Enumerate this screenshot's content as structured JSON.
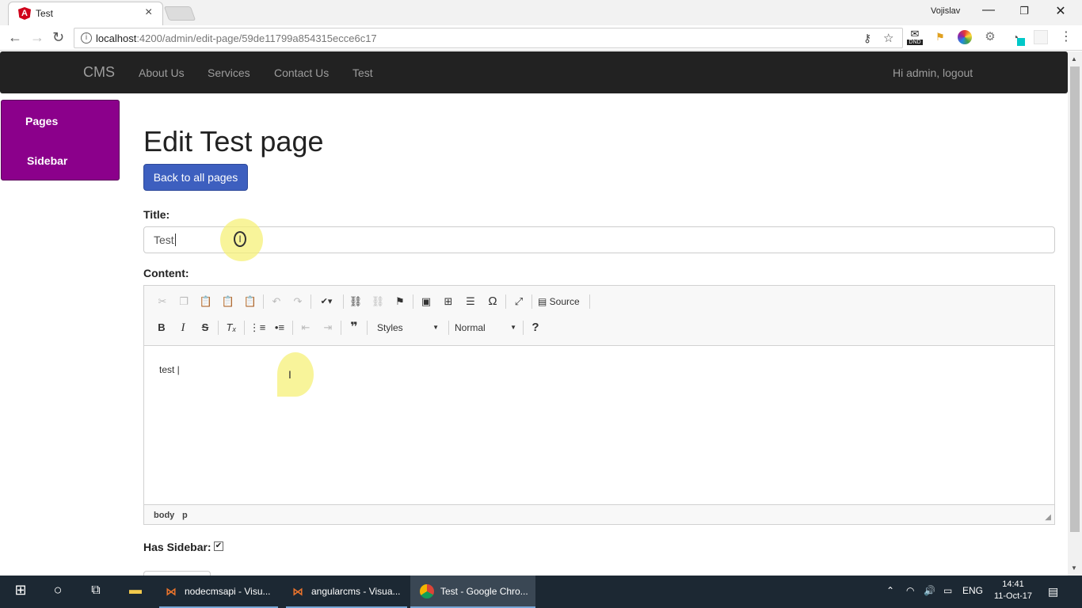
{
  "browser": {
    "tab_title": "Test",
    "tab_favicon": "A",
    "profile_name": "Vojislav",
    "url_host": "localhost",
    "url_path": ":4200/admin/edit-page/59de11799a854315ecce6c17",
    "ext_dnd": "DND"
  },
  "navbar": {
    "brand": "CMS",
    "links": [
      "About Us",
      "Services",
      "Contact Us",
      "Test"
    ],
    "user": "Hi admin, logout"
  },
  "sidebar": {
    "items": [
      "Pages",
      "Sidebar"
    ]
  },
  "main": {
    "heading": "Edit Test page",
    "back_label": "Back to all pages",
    "title_label": "Title:",
    "title_value": "Test",
    "content_label": "Content:",
    "has_sidebar_label": "Has Sidebar:",
    "has_sidebar_checked": true
  },
  "editor": {
    "source_label": "Source",
    "styles_label": "Styles",
    "format_label": "Normal",
    "content_text": "test |",
    "path": [
      "body",
      "p"
    ]
  },
  "taskbar": {
    "tasks": [
      {
        "label": "nodecmsapi - Visu...",
        "icon": "vscode-icon"
      },
      {
        "label": "angularcms - Visua...",
        "icon": "vscode-icon"
      },
      {
        "label": "Test - Google Chro...",
        "icon": "chrome-icon"
      }
    ],
    "lang": "ENG",
    "time": "14:41",
    "date": "11-Oct-17"
  },
  "colors": {
    "navbar_bg": "#222222",
    "sidebar_bg": "#8b008b",
    "primary_button": "#3d5fbf",
    "taskbar_bg": "#1c2833"
  }
}
